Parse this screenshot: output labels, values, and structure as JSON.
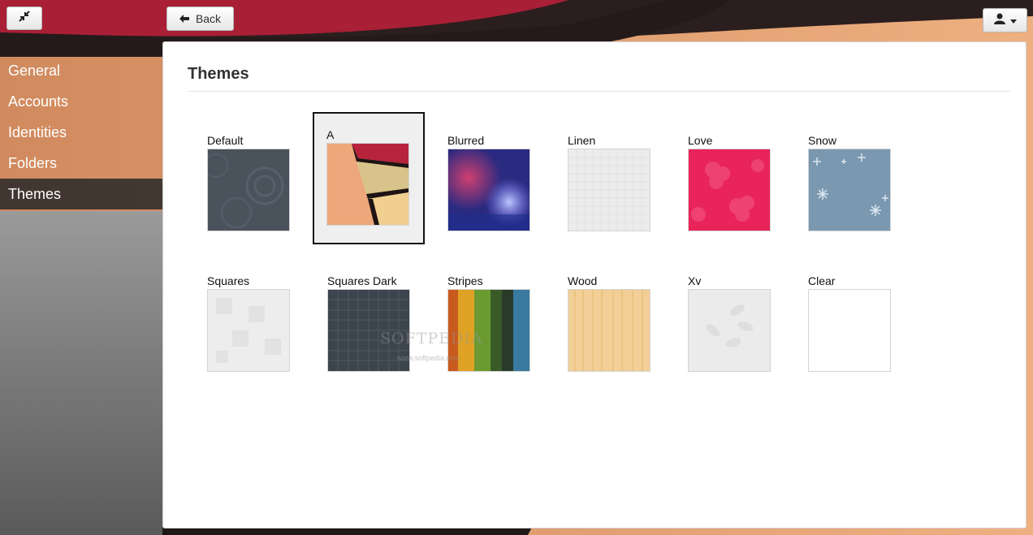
{
  "toolbar": {
    "collapse_icon": "collapse-arrows-icon",
    "back_label": "Back",
    "back_icon": "arrow-left-icon",
    "user_icon": "user-icon",
    "user_dropdown_icon": "caret-down-icon"
  },
  "sidebar": {
    "items": [
      {
        "label": "General",
        "active": false
      },
      {
        "label": "Accounts",
        "active": false
      },
      {
        "label": "Identities",
        "active": false
      },
      {
        "label": "Folders",
        "active": false
      },
      {
        "label": "Themes",
        "active": true
      }
    ]
  },
  "main": {
    "title": "Themes",
    "themes": [
      {
        "label": "Default",
        "selected": false
      },
      {
        "label": "A",
        "selected": true
      },
      {
        "label": "Blurred",
        "selected": false
      },
      {
        "label": "Linen",
        "selected": false
      },
      {
        "label": "Love",
        "selected": false
      },
      {
        "label": "Snow",
        "selected": false
      },
      {
        "label": "Squares",
        "selected": false
      },
      {
        "label": "Squares Dark",
        "selected": false
      },
      {
        "label": "Stripes",
        "selected": false
      },
      {
        "label": "Wood",
        "selected": false
      },
      {
        "label": "Xv",
        "selected": false
      },
      {
        "label": "Clear",
        "selected": false
      }
    ]
  },
  "watermark": {
    "text": "SOFTPEDIA",
    "sub": "www.softpedia.com"
  },
  "colors": {
    "active_sidebar": "#2a2a2a",
    "panel_bg": "#ffffff",
    "wallpaper_red": "#b3223a",
    "wallpaper_peach": "#e8a070"
  }
}
